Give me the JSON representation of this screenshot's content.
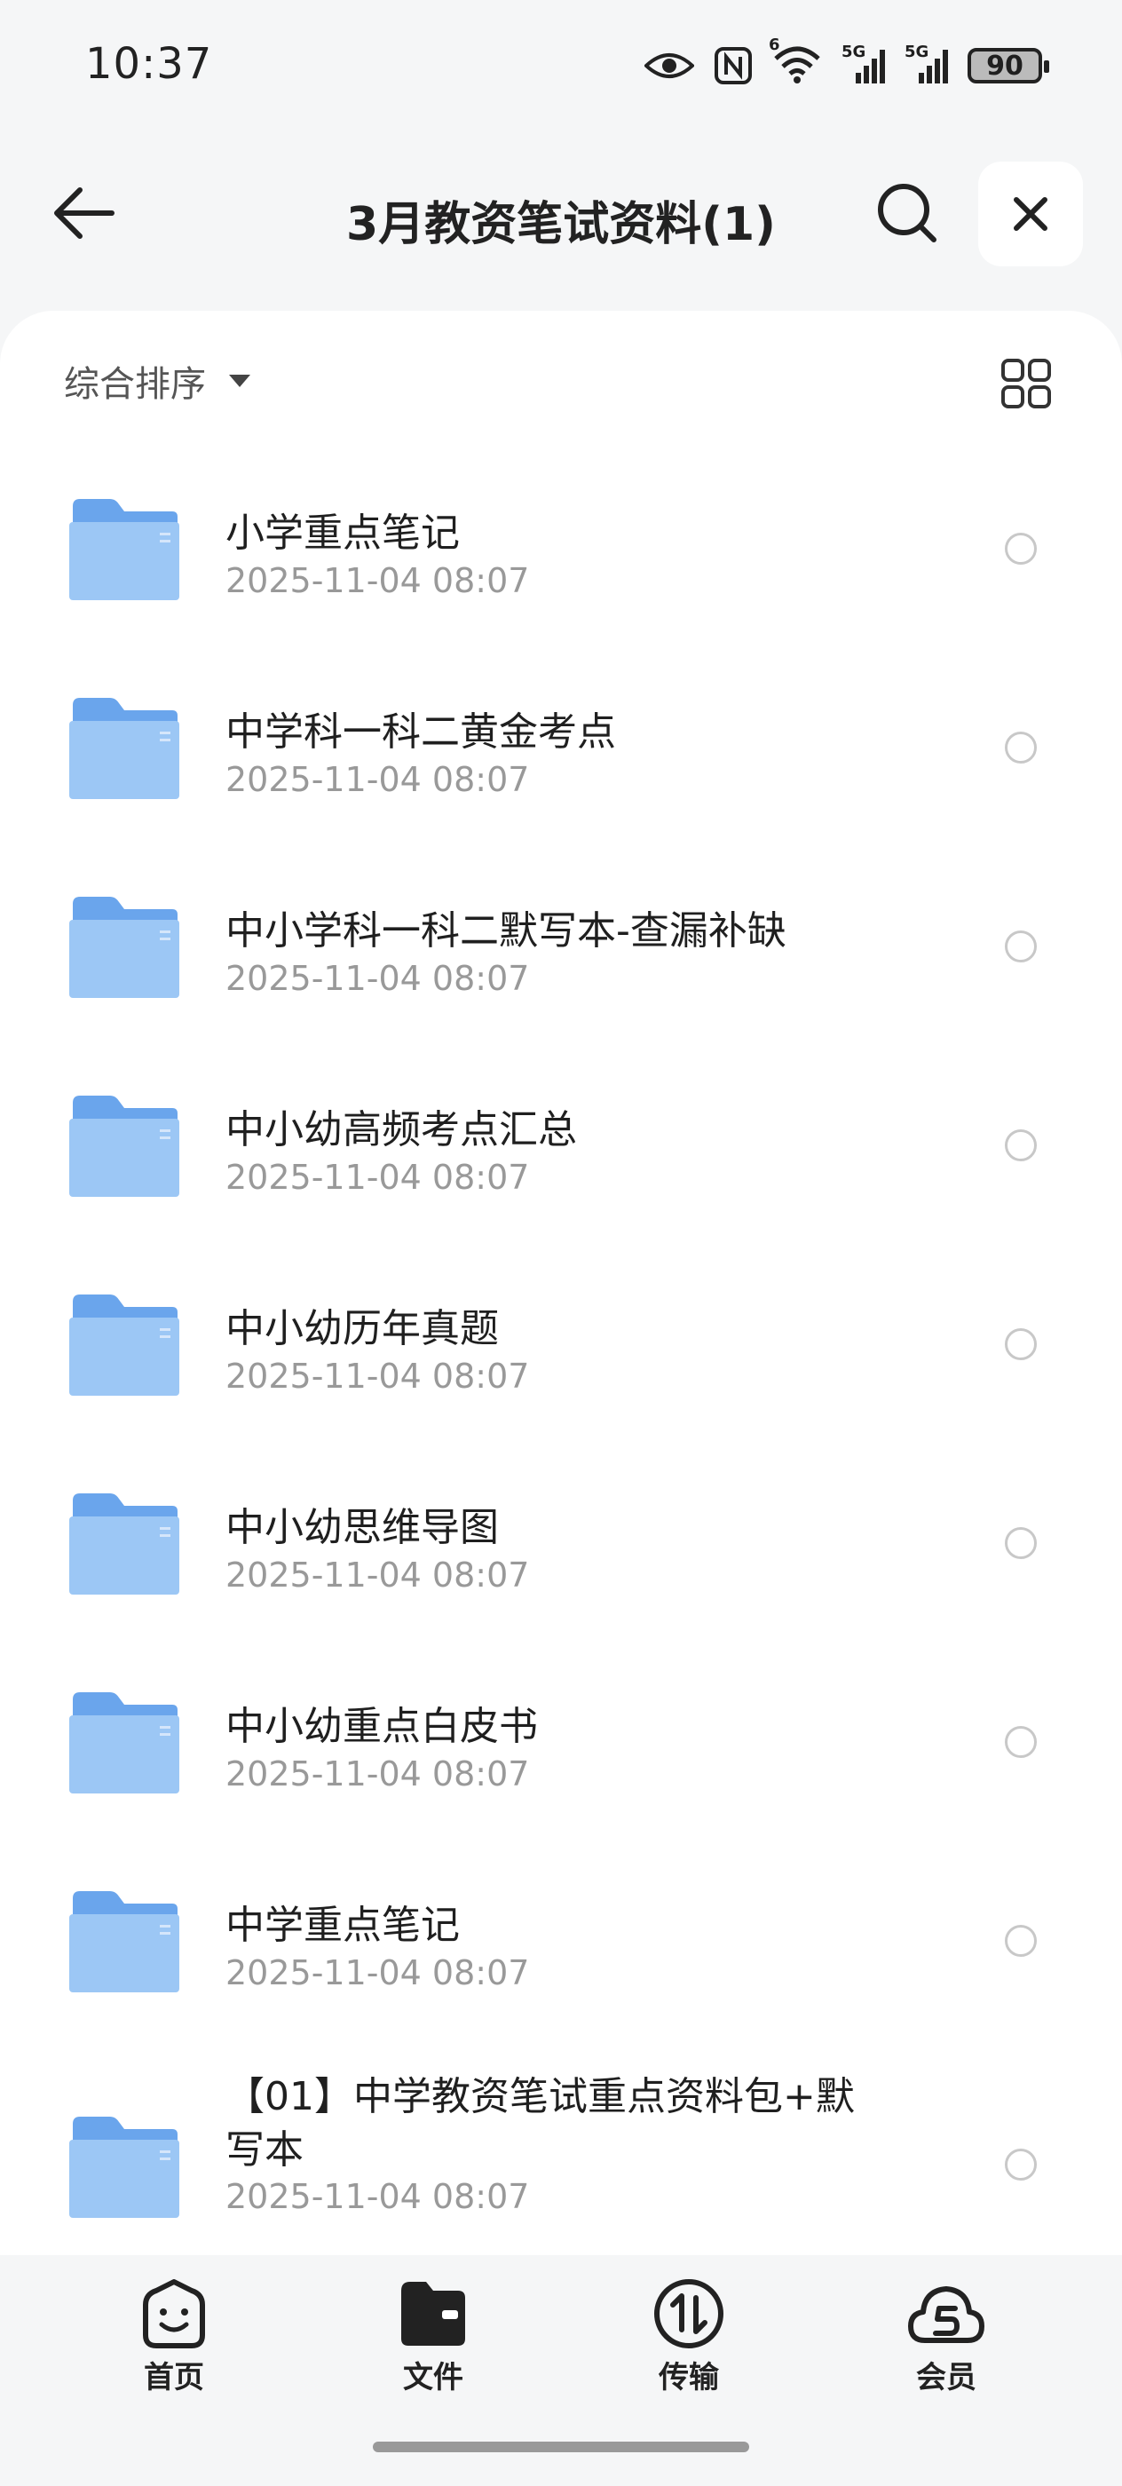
{
  "status_bar": {
    "time": "10:37",
    "battery": "90",
    "signal1_label": "5G",
    "signal2_label": "5G",
    "wifi_label": "6",
    "icons": [
      "eye-icon",
      "nfc-icon",
      "wifi-icon",
      "signal-icon",
      "signal-icon",
      "battery-icon"
    ]
  },
  "header": {
    "title": "3月教资笔试资料(1)"
  },
  "toolbar": {
    "sort_label": "综合排序"
  },
  "files": [
    {
      "name": "小学重点笔记",
      "date": "2025-11-04 08:07"
    },
    {
      "name": "中学科一科二黄金考点",
      "date": "2025-11-04 08:07"
    },
    {
      "name": "中小学科一科二默写本-查漏补缺",
      "date": "2025-11-04 08:07"
    },
    {
      "name": "中小幼高频考点汇总",
      "date": "2025-11-04 08:07"
    },
    {
      "name": "中小幼历年真题",
      "date": "2025-11-04 08:07"
    },
    {
      "name": "中小幼思维导图",
      "date": "2025-11-04 08:07"
    },
    {
      "name": "中小幼重点白皮书",
      "date": "2025-11-04 08:07"
    },
    {
      "name": "中学重点笔记",
      "date": "2025-11-04 08:07"
    },
    {
      "name": "【01】中学教资笔试重点资料包+默写本",
      "date": "2025-11-04 08:07"
    }
  ],
  "bottom_nav": {
    "home": "首页",
    "files": "文件",
    "transfer": "传输",
    "vip": "会员"
  },
  "colors": {
    "folder": "#7fb3f0",
    "accent": "#222222"
  }
}
